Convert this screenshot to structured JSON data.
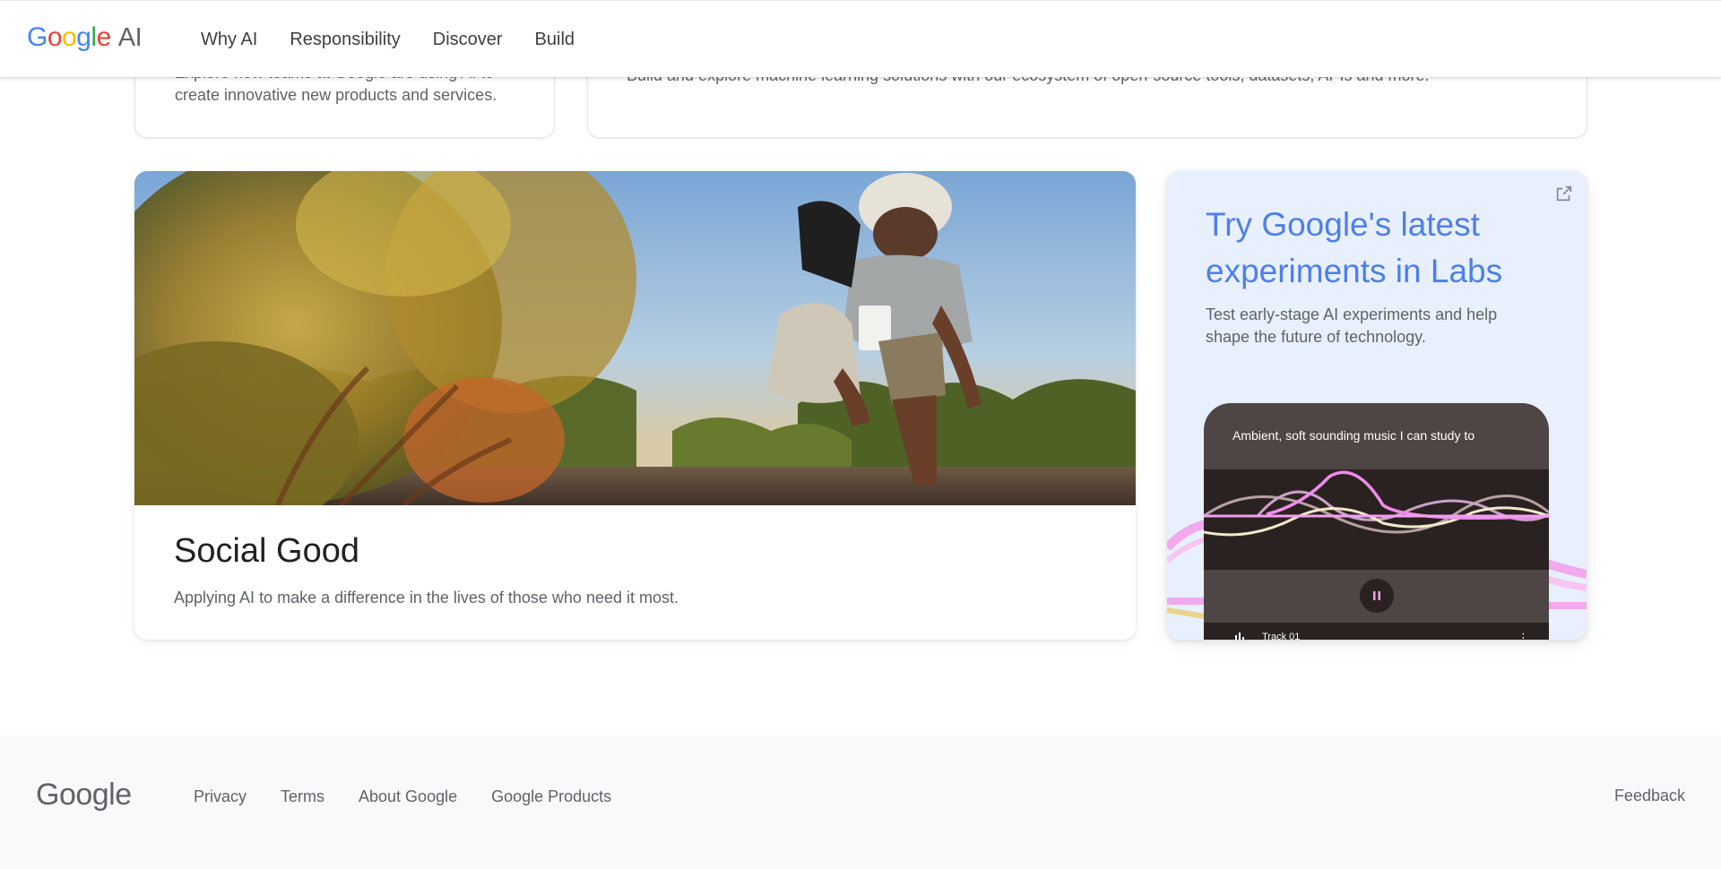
{
  "header": {
    "logo_letters": [
      "G",
      "o",
      "o",
      "g",
      "l",
      "e"
    ],
    "logo_suffix": "AI",
    "nav": [
      "Why AI",
      "Responsibility",
      "Discover",
      "Build"
    ]
  },
  "top_cards": {
    "left_desc": "Explore how teams at Google are using AI to create innovative new products and services.",
    "right_desc": "Build and explore machine learning solutions with our ecosystem of open-source tools, datasets, APIs and more."
  },
  "social_card": {
    "title": "Social Good",
    "desc": "Applying AI to make a difference in the lives of those who need it most."
  },
  "labs_card": {
    "title": "Try Google's latest experiments in Labs",
    "desc": "Test early-stage AI experiments and help shape the future of technology.",
    "phone_prompt": "Ambient, soft sounding music I can study to",
    "track": "Track 01"
  },
  "footer": {
    "logo": "Google",
    "links": [
      "Privacy",
      "Terms",
      "About Google",
      "Google Products"
    ],
    "feedback": "Feedback"
  },
  "colors": {
    "brand_blue": "#4285f4",
    "labs_title": "#4f7fe5",
    "labs_bg": "#e8f0fe"
  }
}
